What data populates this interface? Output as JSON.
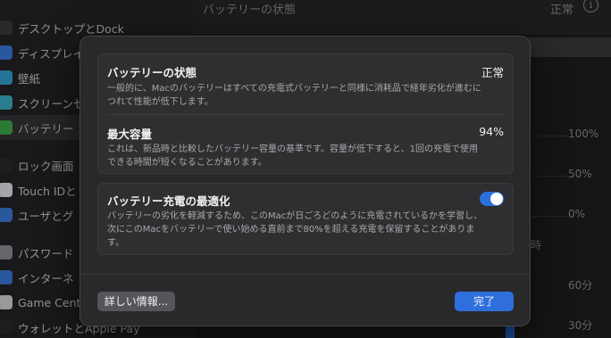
{
  "sidebar": {
    "items": [
      {
        "label": "デスクトップとDock",
        "icon": "dock-icon",
        "color": "#3a3a3d"
      },
      {
        "label": "ディスプレイ",
        "icon": "display-icon",
        "color": "#3a7ad8"
      },
      {
        "label": "壁紙",
        "icon": "wallpaper-icon",
        "color": "#35a3d4"
      },
      {
        "label": "スクリーンセ",
        "icon": "screensaver-icon",
        "color": "#3ab0c4"
      },
      {
        "label": "バッテリー",
        "icon": "battery-icon",
        "color": "#3fa94a"
      },
      {
        "label": "ロック画面",
        "icon": "lock-screen-icon",
        "color": "#2a2a2c"
      },
      {
        "label": "Touch IDと",
        "icon": "touch-id-icon",
        "color": "#e5e5ea"
      },
      {
        "label": "ユーザとグ",
        "icon": "users-icon",
        "color": "#3a7ad8"
      },
      {
        "label": "パスワード",
        "icon": "password-icon",
        "color": "#8e8e93"
      },
      {
        "label": "インターネ",
        "icon": "internet-icon",
        "color": "#3a7ad8"
      },
      {
        "label": "Game Cent",
        "icon": "game-center-icon",
        "color": "#d4d4d8"
      },
      {
        "label": "ウォレットとApple Pay",
        "icon": "wallet-icon",
        "color": "#2a2a2c"
      }
    ]
  },
  "background": {
    "top_label": "バッテリーの状態",
    "top_value": "正常",
    "info_symbol": "i",
    "chart_labels": [
      "100%",
      "50%",
      "0%",
      "60分",
      "30分"
    ],
    "partial_text": "時"
  },
  "dialog": {
    "battery_health": {
      "title": "バッテリーの状態",
      "value": "正常",
      "description": "一般的に、Macのバッテリーはすべての充電式バッテリーと同様に消耗品で経年劣化が進むにつれて性能が低下します。"
    },
    "max_capacity": {
      "title": "最大容量",
      "value": "94%",
      "description": "これは、新品時と比較したバッテリー容量の基準です。容量が低下すると、1回の充電で使用できる時間が短くなることがあります。"
    },
    "optimized_charging": {
      "title": "バッテリー充電の最適化",
      "enabled": true,
      "description": "バッテリーの劣化を軽減するため、このMacが日ごろどのように充電されているかを学習し、次にこのMacをバッテリーで使い始める直前まで80%を超える充電を保留することがあります。"
    },
    "more_info_label": "詳しい情報...",
    "done_label": "完了",
    "accent_color": "#2f6fdd"
  }
}
